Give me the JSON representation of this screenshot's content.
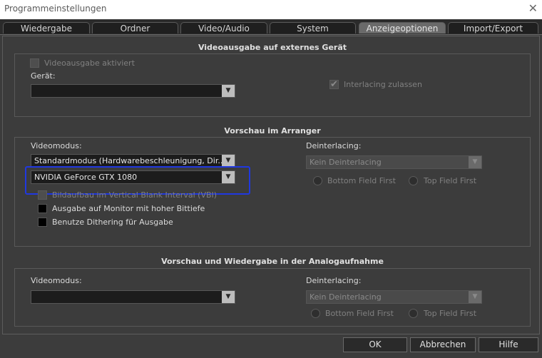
{
  "window": {
    "title": "Programmeinstellungen"
  },
  "tabs": [
    {
      "label": "Wiedergabe"
    },
    {
      "label": "Ordner"
    },
    {
      "label": "Video/Audio"
    },
    {
      "label": "System"
    },
    {
      "label": "Anzeigeoptionen"
    },
    {
      "label": "Import/Export"
    }
  ],
  "active_tab": "Anzeigeoptionen",
  "external_device": {
    "title": "Videoausgabe auf externes Gerät",
    "enable_label": "Videoausgabe aktiviert",
    "device_label": "Gerät:",
    "device_value": "",
    "interlacing_label": "Interlacing zulassen"
  },
  "arranger_preview": {
    "title": "Vorschau im Arranger",
    "videomode_label": "Videomodus:",
    "videomode_value": "Standardmodus (Hardwarebeschleunigung, Dir...",
    "gpu_value": "NVIDIA GeForce GTX 1080",
    "vbi_label": "Bildaufbau im Vertical Blank Interval (VBI)",
    "high_bit_label": "Ausgabe auf Monitor mit hoher Bittiefe",
    "dithering_label": "Benutze Dithering für Ausgabe",
    "deinterlacing_label": "Deinterlacing:",
    "deinterlacing_value": "Kein Deinterlacing",
    "bottom_field_label": "Bottom Field First",
    "top_field_label": "Top Field First"
  },
  "analog_preview": {
    "title": "Vorschau und Wiedergabe in der Analogaufnahme",
    "videomode_label": "Videomodus:",
    "videomode_value": "",
    "deinterlacing_label": "Deinterlacing:",
    "deinterlacing_value": "Kein Deinterlacing",
    "bottom_field_label": "Bottom Field First",
    "top_field_label": "Top Field First"
  },
  "buttons": {
    "ok": "OK",
    "cancel": "Abbrechen",
    "help": "Hilfe"
  },
  "icons": {
    "close": "close-icon",
    "dropdown": "chevron-down-icon",
    "checkmark": "checkmark-icon"
  },
  "colors": {
    "highlight": "#2038e0",
    "background": "#3c3c3c"
  }
}
